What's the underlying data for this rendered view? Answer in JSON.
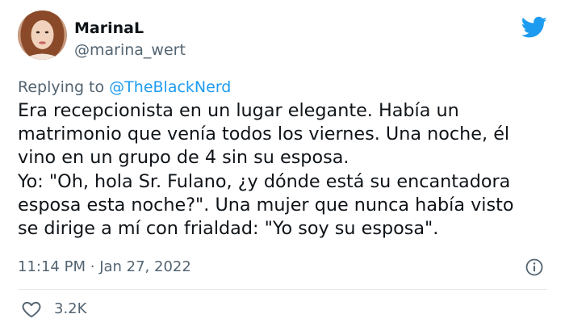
{
  "author": {
    "display_name": "MarinaL",
    "handle": "@marina_wert",
    "avatar_icon": "profile-photo"
  },
  "reply_context": {
    "prefix": "Replying to",
    "mention": "@TheBlackNerd"
  },
  "body_lines": [
    "Era recepcionista en un lugar elegante. Había un",
    "matrimonio que venía todos los viernes. Una noche, él",
    "vino en un grupo de 4 sin su esposa.",
    "Yo: \"Oh, hola Sr. Fulano, ¿y dónde está su encantadora",
    "esposa esta noche?\". Una mujer que nunca había visto",
    "se dirige a mí con frialdad: \"Yo soy su esposa\"."
  ],
  "meta": {
    "time": "11:14 PM",
    "separator": "·",
    "date": "Jan 27, 2022"
  },
  "engagement": {
    "likes": "3.2K"
  },
  "colors": {
    "brand": "#1d9bf0",
    "text_primary": "#0f1419",
    "text_secondary": "#536471",
    "divider": "#e6e9ec"
  },
  "icons": {
    "brand": "twitter-bird-icon",
    "info": "info-icon",
    "like": "heart-icon"
  }
}
